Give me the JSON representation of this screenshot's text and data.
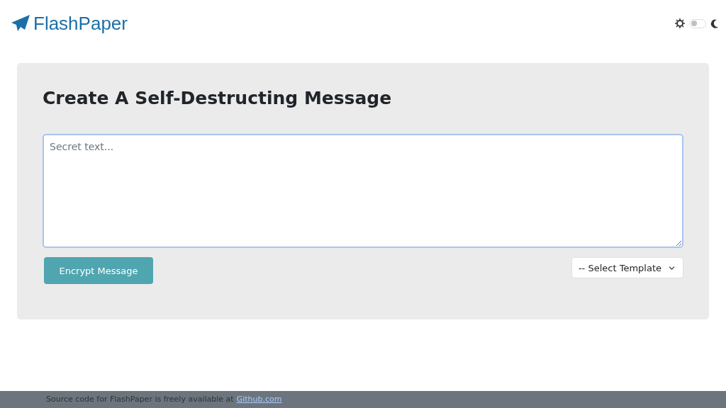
{
  "header": {
    "logo": "FlashPaper",
    "dark_mode": false
  },
  "card": {
    "title": "Create A Self-Destructing Message",
    "message": {
      "placeholder": "Secret text..."
    },
    "encrypt_button": "Encrypt Message",
    "template_select": "-- Select Template"
  },
  "footer": {
    "text": "Source code for FlashPaper is freely available at",
    "link": "Github.com"
  }
}
